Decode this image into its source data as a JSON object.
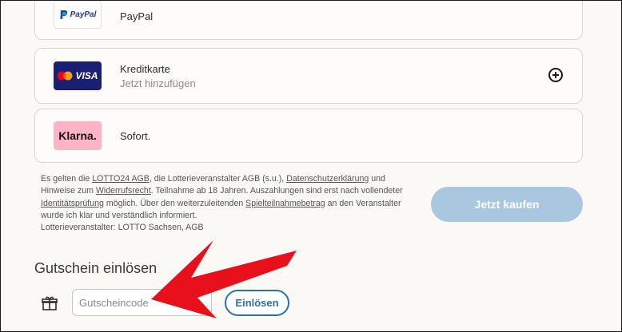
{
  "payment_methods": [
    {
      "title": "PayPal",
      "subtitle": "",
      "logo_text": "PayPal",
      "logo_icon": "paypal-logo"
    },
    {
      "title": "Kreditkarte",
      "subtitle": "Jetzt hinzufügen",
      "logo_text": "VISA",
      "logo_icon": "mastercard-visa-logo",
      "action_icon": "plus-circle-icon"
    },
    {
      "title": "Sofort.",
      "subtitle": "",
      "logo_text": "Klarna.",
      "logo_icon": "klarna-logo"
    }
  ],
  "terms": {
    "t1": "Es gelten die ",
    "link_agb": "LOTTO24 AGB",
    "t2": ", die Lotterieveranstalter AGB (s.u.), ",
    "link_privacy": "Datenschutzerklärung",
    "t3": " und Hinweise zum ",
    "link_withdrawal": "Widerrufsrecht",
    "t4": ". Teilnahme ab 18 Jahren. Auszahlungen sind erst nach vollendeter ",
    "link_identity": "Identitätsprüfung",
    "t5": " möglich. Über den weiterzuleitenden ",
    "link_stake": "Spielteilnahmebetrag",
    "t6": " an den Veranstalter wurde ich klar und verständlich informiert.",
    "organizer": "Lotterieveranstalter: LOTTO Sachsen, AGB"
  },
  "buy_button": {
    "label": "Jetzt kaufen"
  },
  "voucher": {
    "heading": "Gutschein einlösen",
    "placeholder": "Gutscheincode",
    "value": "",
    "redeem_label": "Einlösen",
    "icon": "gift-icon"
  },
  "annotation": {
    "icon": "red-arrow-icon",
    "color": "#e8101a"
  },
  "colors": {
    "background": "#fbf9f5",
    "buy_button": "#a9c7df",
    "redeem_accent": "#2a6fb0",
    "klarna_pink": "#ffb3c7",
    "visa_blue": "#1a1f71",
    "paypal_blue": "#253b80"
  }
}
